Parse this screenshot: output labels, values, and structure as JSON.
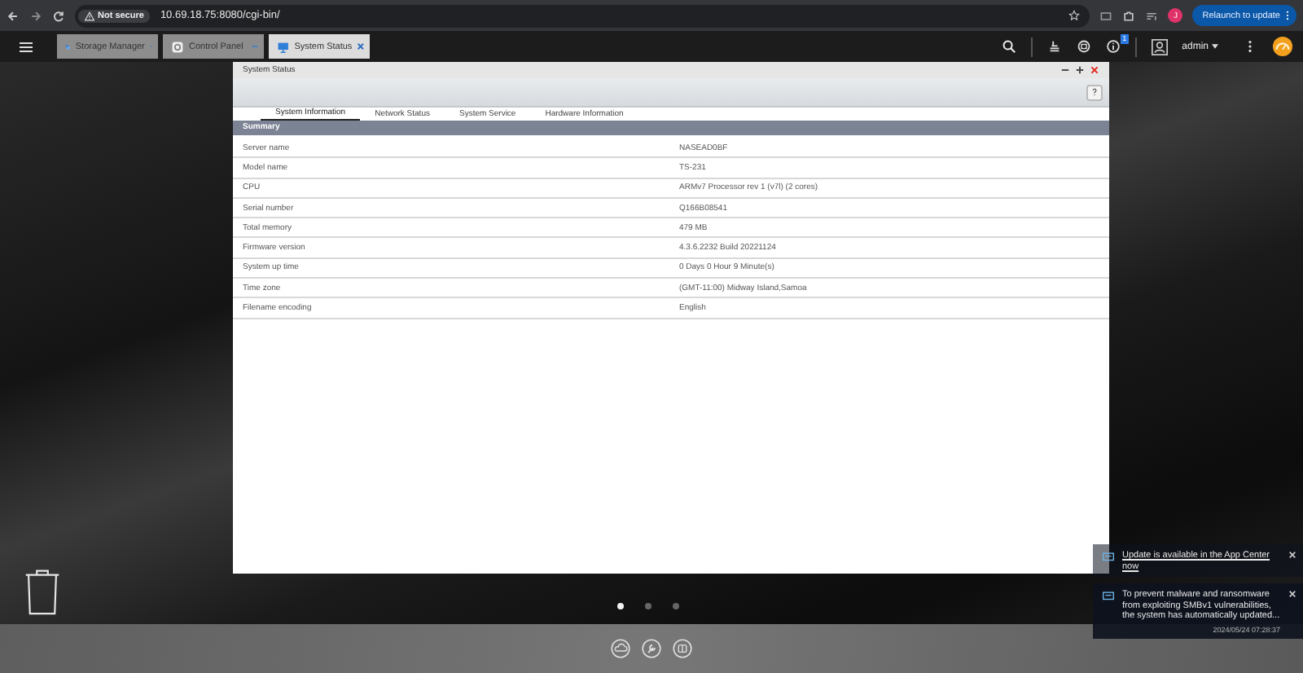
{
  "browser": {
    "security_label": "Not secure",
    "url": "10.69.18.75:8080/cgi-bin/",
    "profile_initial": "J",
    "relaunch_button": "Relaunch to update"
  },
  "app_tabs": [
    {
      "label": "Storage Manager",
      "selected": false
    },
    {
      "label": "Control Panel",
      "selected": false
    },
    {
      "label": "System Status",
      "selected": true
    }
  ],
  "toolbar": {
    "notification_count": "1",
    "user": "admin"
  },
  "window": {
    "title": "System Status",
    "tabs": [
      {
        "label": "System Information",
        "selected": true
      },
      {
        "label": "Network Status",
        "selected": false
      },
      {
        "label": "System Service",
        "selected": false
      },
      {
        "label": "Hardware Information",
        "selected": false
      }
    ],
    "section": "Summary",
    "rows": [
      {
        "label": "Server name",
        "value": "NASEAD0BF"
      },
      {
        "label": "Model name",
        "value": "TS-231"
      },
      {
        "label": "CPU",
        "value": "ARMv7 Processor rev 1 (v7l) (2 cores)"
      },
      {
        "label": "Serial number",
        "value": "Q166B08541"
      },
      {
        "label": "Total memory",
        "value": "479 MB"
      },
      {
        "label": "Firmware version",
        "value": "4.3.6.2232 Build 20221124"
      },
      {
        "label": "System up time",
        "value": "0 Days 0 Hour 9 Minute(s)"
      },
      {
        "label": "Time zone",
        "value": "(GMT-11:00) Midway Island,Samoa"
      },
      {
        "label": "Filename encoding",
        "value": "English"
      }
    ]
  },
  "page_dots": [
    {
      "selected": true
    },
    {
      "selected": false
    },
    {
      "selected": false
    }
  ],
  "notifications": [
    {
      "kind": "link",
      "text": "Update is available in the App Center now"
    },
    {
      "kind": "message",
      "text": "To prevent malware and ransomware from exploiting SMBv1 vulnerabilities, the system has automatically updated...",
      "time": "2024/05/24 07:28:37"
    }
  ]
}
